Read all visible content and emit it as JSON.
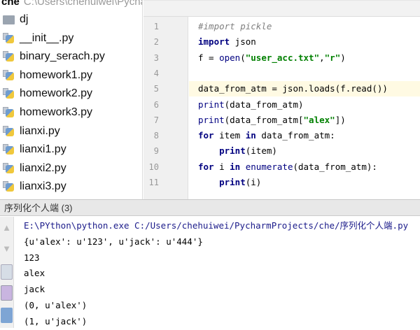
{
  "project": {
    "name": "che",
    "path": "C:\\Users\\chehuiwei\\PycharmProjects\\che"
  },
  "tree": [
    {
      "label": "dj",
      "type": "folder"
    },
    {
      "label": "__init__.py",
      "type": "py"
    },
    {
      "label": "binary_serach.py",
      "type": "py"
    },
    {
      "label": "homework1.py",
      "type": "py"
    },
    {
      "label": "homework2.py",
      "type": "py"
    },
    {
      "label": "homework3.py",
      "type": "py"
    },
    {
      "label": "lianxi.py",
      "type": "py"
    },
    {
      "label": "lianxi1.py",
      "type": "py"
    },
    {
      "label": "lianxi2.py",
      "type": "py"
    },
    {
      "label": "lianxi3.py",
      "type": "py"
    }
  ],
  "editor": {
    "current_line": 5,
    "lines": [
      {
        "n": "1",
        "html": "<span class='cm'>#import pickle</span>"
      },
      {
        "n": "2",
        "html": "<span class='kw'>import</span> json"
      },
      {
        "n": "3",
        "html": "f = <span class='bi'>open</span>(<span class='st'>\"user_acc.txt\"</span>,<span class='st'>\"r\"</span>)"
      },
      {
        "n": "4",
        "html": ""
      },
      {
        "n": "5",
        "html": "data_from_atm = json.loads(f.read())"
      },
      {
        "n": "6",
        "html": "<span class='bi'>print</span>(data_from_atm)"
      },
      {
        "n": "7",
        "html": "<span class='bi'>print</span>(data_from_atm[<span class='st'>\"alex\"</span>])"
      },
      {
        "n": "8",
        "html": "<span class='kw'>for</span> item <span class='kw'>in</span> data_from_atm:"
      },
      {
        "n": "9",
        "html": "    <span class='kw'>print</span>(item)"
      },
      {
        "n": "10",
        "html": "<span class='kw'>for</span> i <span class='kw'>in</span> <span class='bi'>enumerate</span>(data_from_atm):"
      },
      {
        "n": "11",
        "html": "    <span class='kw'>print</span>(i)"
      }
    ]
  },
  "console": {
    "title": "序列化个人端 (3)",
    "lines": [
      "E:\\PYthon\\python.exe C:/Users/chehuiwei/PycharmProjects/che/序列化个人端.py",
      "{u'alex': u'123', u'jack': u'444'}",
      "123",
      "alex",
      "jack",
      "(0, u'alex')",
      "(1, u'jack')"
    ]
  }
}
